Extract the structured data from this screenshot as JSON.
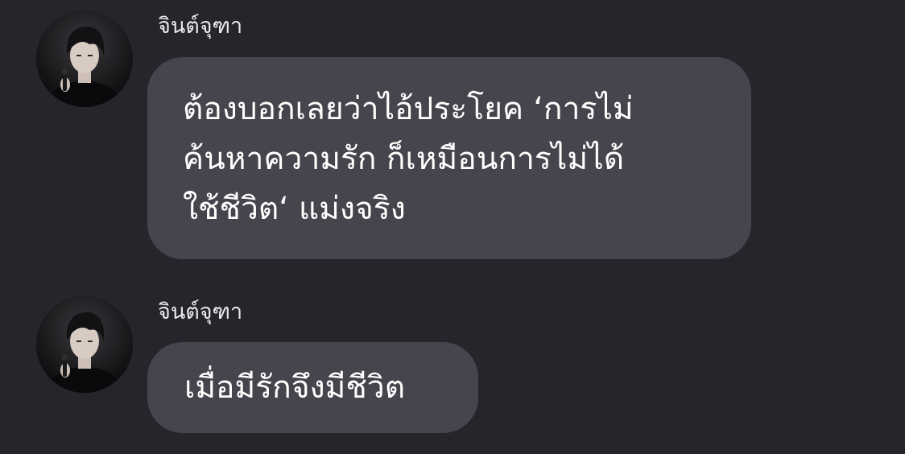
{
  "messages": [
    {
      "sender": "จินต์จุฑา",
      "lines": [
        "ต้องบอกเลยว่าไอ้ประโยค ‘การไม่",
        "ค้นหาความรัก ก็เหมือนการไม่ได้",
        "ใช้ชีวิต‘ แม่งจริง"
      ]
    },
    {
      "sender": "จินต์จุฑา",
      "lines": [
        "เมื่อมีรักจึงมีชีวิต"
      ]
    }
  ],
  "colors": {
    "background": "#25252c",
    "bubble": "#45454d",
    "text": "#ffffff",
    "sender_text": "#e9e9ec"
  }
}
